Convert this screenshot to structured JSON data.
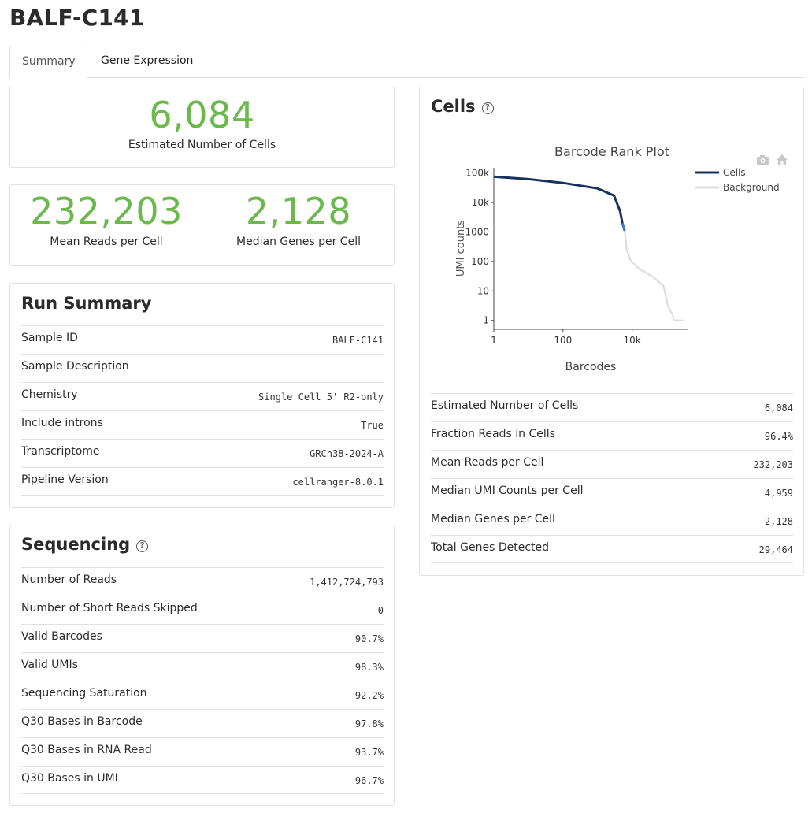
{
  "page": {
    "title": "BALF-C141"
  },
  "tabs": [
    {
      "label": "Summary",
      "active": true
    },
    {
      "label": "Gene Expression",
      "active": false
    }
  ],
  "highlight": {
    "cells": {
      "value": "6,084",
      "label": "Estimated Number of Cells"
    },
    "mean_reads": {
      "value": "232,203",
      "label": "Mean Reads per Cell"
    },
    "median_genes": {
      "value": "2,128",
      "label": "Median Genes per Cell"
    },
    "color": "#6ab94b"
  },
  "run_summary": {
    "title": "Run Summary",
    "rows": [
      {
        "key": "Sample ID",
        "value": "BALF-C141"
      },
      {
        "key": "Sample Description",
        "value": ""
      },
      {
        "key": "Chemistry",
        "value": "Single Cell 5' R2-only"
      },
      {
        "key": "Include introns",
        "value": "True"
      },
      {
        "key": "Transcriptome",
        "value": "GRCh38-2024-A"
      },
      {
        "key": "Pipeline Version",
        "value": "cellranger-8.0.1"
      }
    ]
  },
  "sequencing": {
    "title": "Sequencing",
    "help_icon": "question-circle-icon",
    "rows": [
      {
        "key": "Number of Reads",
        "value": "1,412,724,793"
      },
      {
        "key": "Number of Short Reads Skipped",
        "value": "0"
      },
      {
        "key": "Valid Barcodes",
        "value": "90.7%"
      },
      {
        "key": "Valid UMIs",
        "value": "98.3%"
      },
      {
        "key": "Sequencing Saturation",
        "value": "92.2%"
      },
      {
        "key": "Q30 Bases in Barcode",
        "value": "97.8%"
      },
      {
        "key": "Q30 Bases in RNA Read",
        "value": "93.7%"
      },
      {
        "key": "Q30 Bases in UMI",
        "value": "96.7%"
      }
    ]
  },
  "cells": {
    "title": "Cells",
    "help_icon": "question-circle-icon",
    "rows": [
      {
        "key": "Estimated Number of Cells",
        "value": "6,084"
      },
      {
        "key": "Fraction Reads in Cells",
        "value": "96.4%"
      },
      {
        "key": "Mean Reads per Cell",
        "value": "232,203"
      },
      {
        "key": "Median UMI Counts per Cell",
        "value": "4,959"
      },
      {
        "key": "Median Genes per Cell",
        "value": "2,128"
      },
      {
        "key": "Total Genes Detected",
        "value": "29,464"
      }
    ]
  },
  "toolbar_icons": [
    "camera-icon",
    "home-icon"
  ],
  "chart_data": {
    "type": "line",
    "title": "Barcode Rank Plot",
    "xlabel": "Barcodes",
    "ylabel": "UMI counts",
    "xscale": "log",
    "yscale": "log",
    "xlim": [
      1,
      400000
    ],
    "ylim": [
      0.5,
      150000
    ],
    "x_ticks": [
      "1",
      "100",
      "10k"
    ],
    "y_ticks": [
      "1",
      "10",
      "100",
      "1000",
      "10k",
      "100k"
    ],
    "legend": {
      "position": "top-right",
      "entries": [
        "Cells",
        "Background"
      ]
    },
    "series": [
      {
        "name": "Cells",
        "color": "#17325e",
        "x": [
          1,
          10,
          100,
          1000,
          3000,
          4500,
          5200,
          6084
        ],
        "y": [
          75000,
          62000,
          46000,
          30000,
          17000,
          5000,
          2000,
          1100
        ]
      },
      {
        "name": "Background",
        "color": "#dddddd",
        "x": [
          6084,
          7000,
          9000,
          15000,
          40000,
          80000,
          110000,
          130000,
          150000,
          160000,
          180000,
          300000
        ],
        "y": [
          1100,
          250,
          110,
          60,
          30,
          15,
          3,
          2,
          1.5,
          1,
          1,
          1
        ]
      }
    ],
    "transition_color": "#3a7fc4"
  }
}
